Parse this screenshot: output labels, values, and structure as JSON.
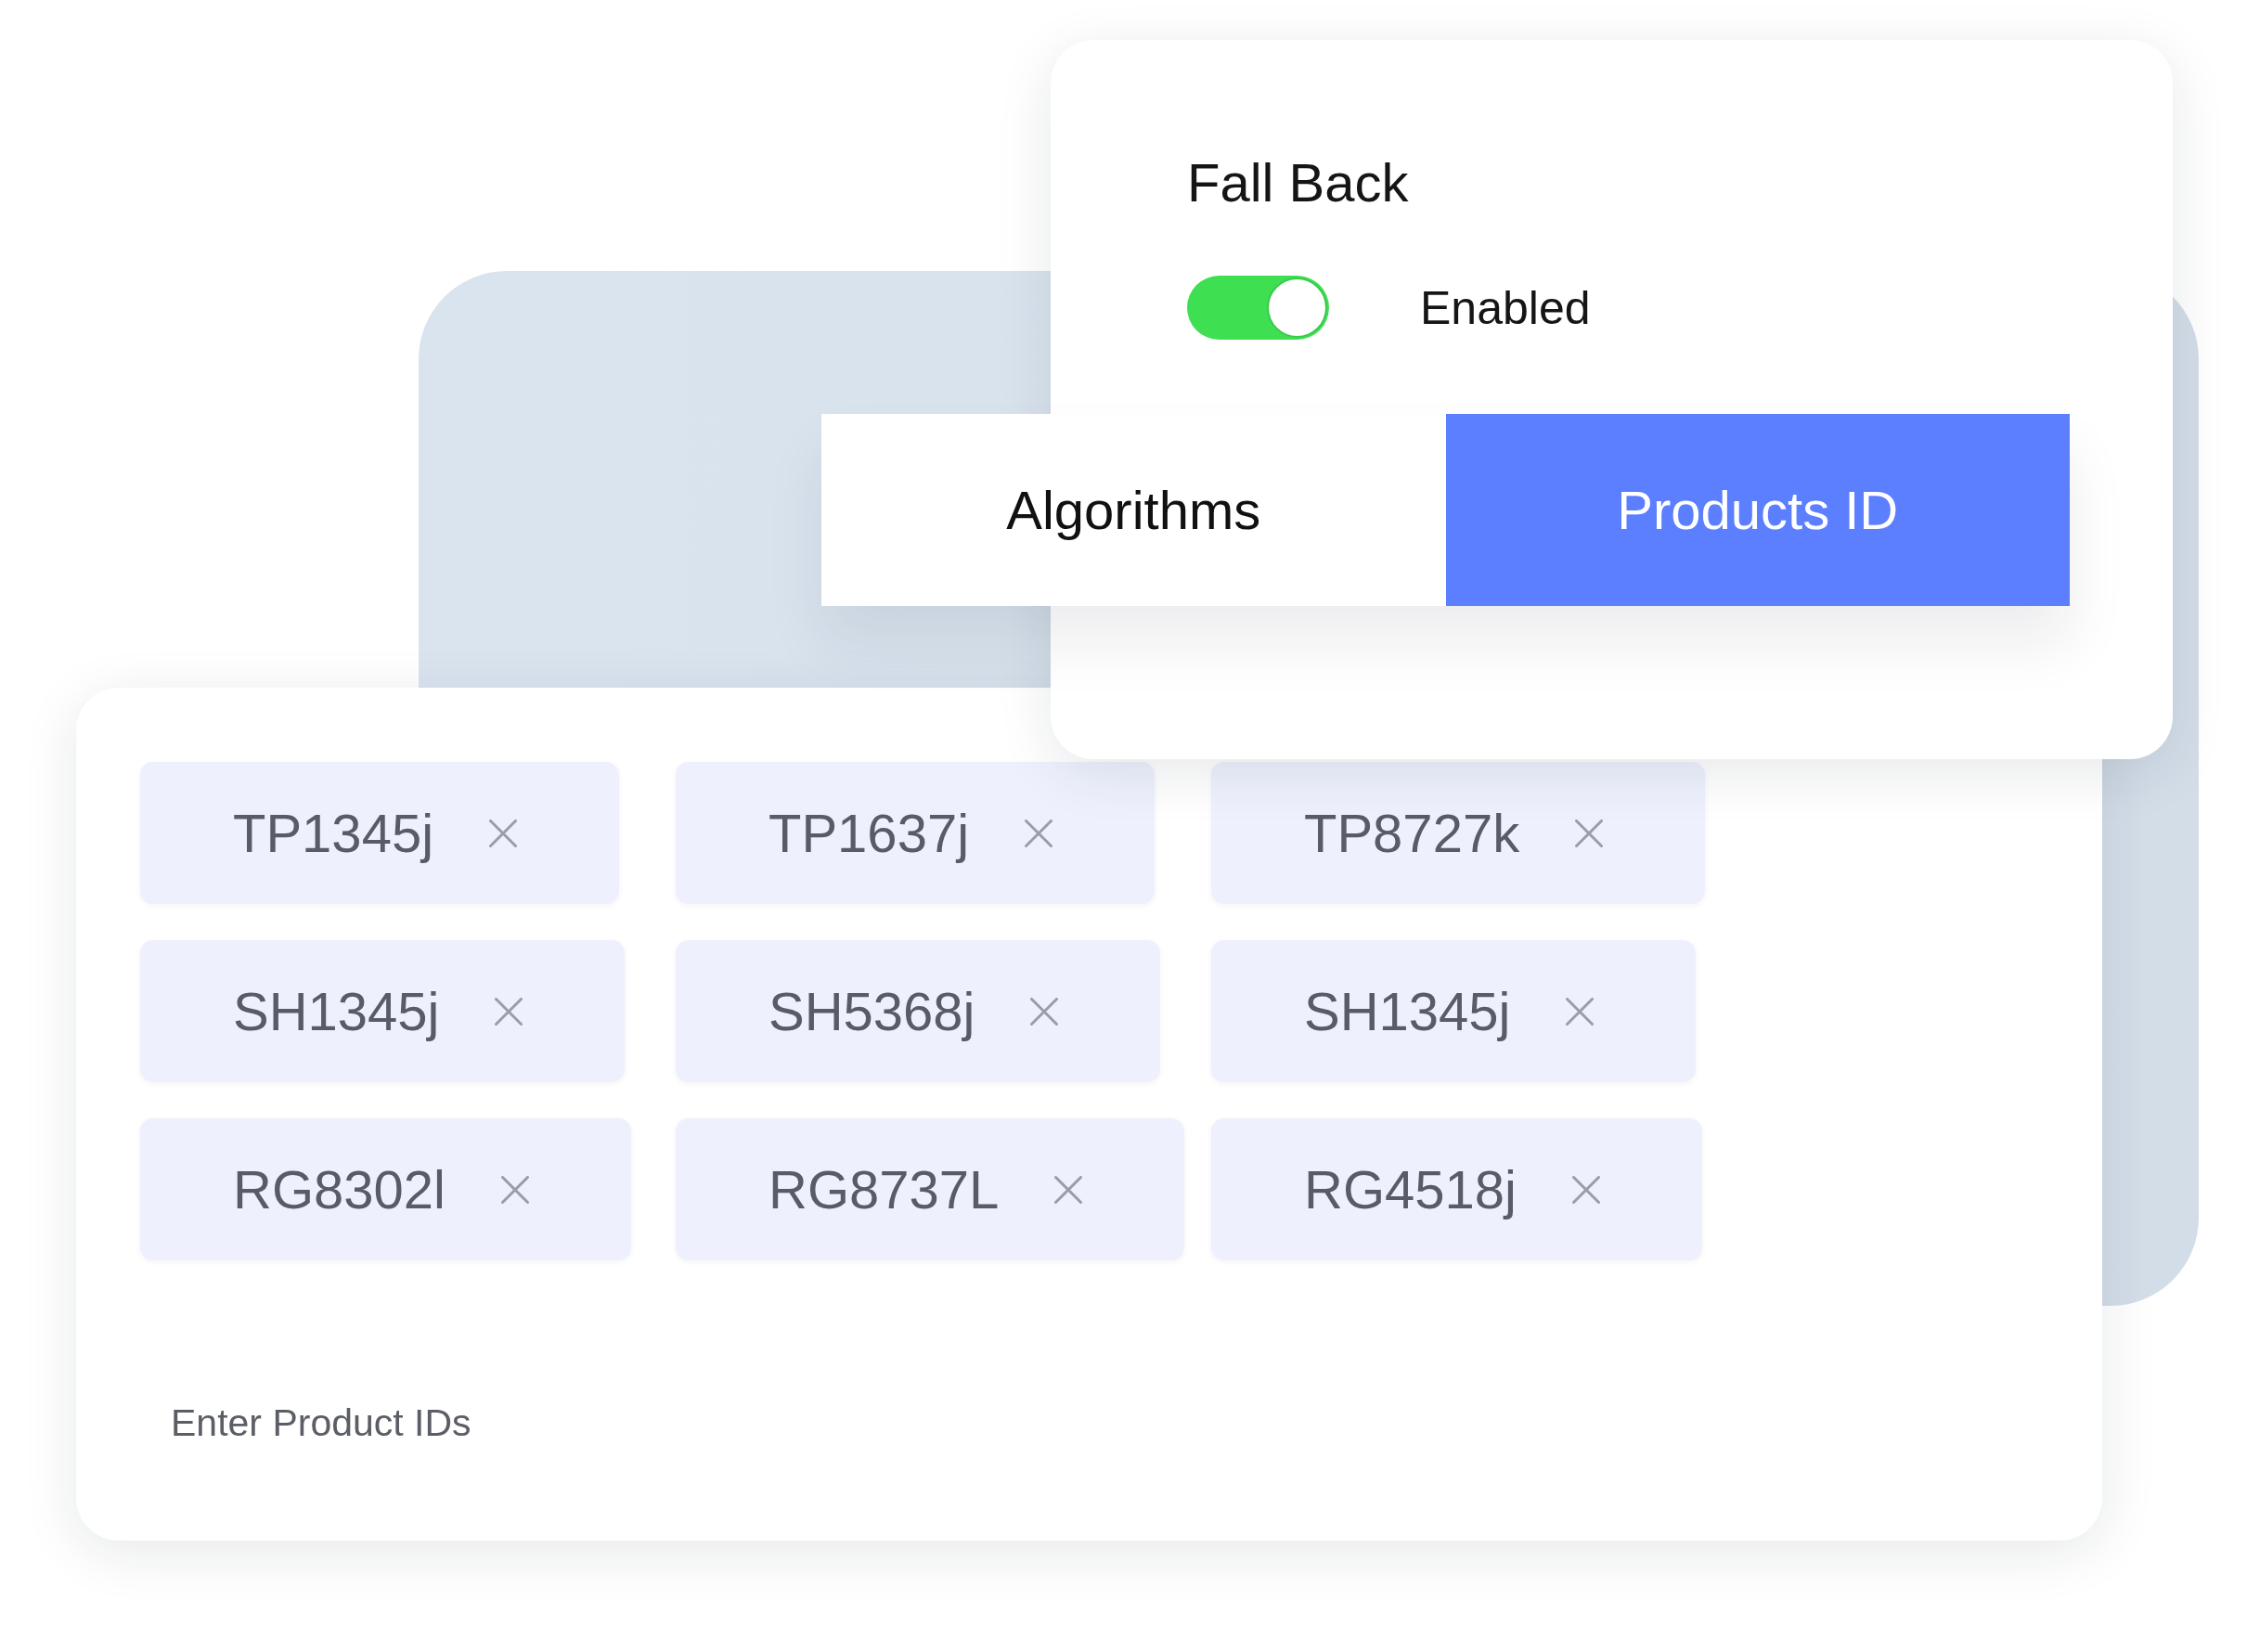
{
  "fallback_panel": {
    "title": "Fall Back",
    "toggle": {
      "on": true,
      "label": "Enabled"
    }
  },
  "tabs": [
    {
      "label": "Algorithms",
      "selected": false
    },
    {
      "label": "Products ID",
      "selected": true
    }
  ],
  "product_ids": {
    "tags": [
      "TP1345j",
      "TP1637j",
      "TP8727k",
      "SH1345j",
      "SH5368j",
      "SH1345j",
      "RG8302l",
      "RG8737L",
      "RG4518j"
    ],
    "input": {
      "placeholder": "Enter Product IDs"
    }
  }
}
